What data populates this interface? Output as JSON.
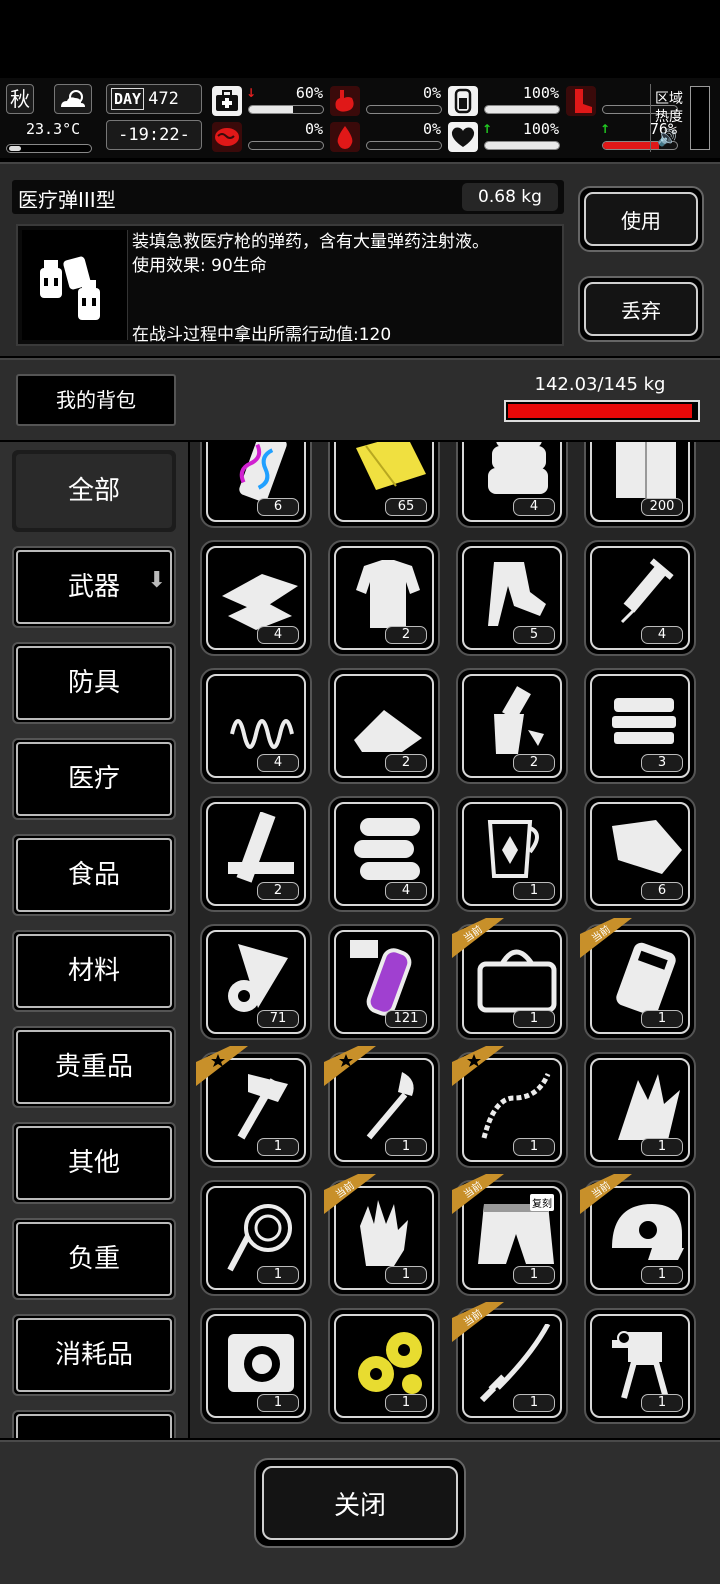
{
  "status": {
    "season": "秋",
    "temperature": "23.3°C",
    "day_label": "DAY",
    "day_number": "472",
    "time": "-19:22-",
    "stats": [
      {
        "key": "health",
        "icon": "medkit-icon",
        "arrow": "↓",
        "arrow_color": "#e02020",
        "value": "60%",
        "level": 0.6,
        "bar_color": "#e8e8e8"
      },
      {
        "key": "hunger",
        "icon": "stomach-icon",
        "arrow": "",
        "arrow_color": "",
        "value": "0%",
        "level": 0.0,
        "bar_color": "#e8e8e8"
      },
      {
        "key": "stamina",
        "icon": "battery-icon",
        "arrow": "",
        "arrow_color": "",
        "value": "100%",
        "level": 1.0,
        "bar_color": "#e8e8e8"
      },
      {
        "key": "leg",
        "icon": "boot-icon",
        "arrow": "",
        "arrow_color": "",
        "value": "",
        "level": 0.0,
        "bar_color": "#e01818"
      },
      {
        "key": "brain",
        "icon": "brain-icon",
        "arrow": "",
        "arrow_color": "",
        "value": "0%",
        "level": 0.0,
        "bar_color": "#e8e8e8"
      },
      {
        "key": "thirst",
        "icon": "water-drop-icon",
        "arrow": "",
        "arrow_color": "",
        "value": "0%",
        "level": 0.0,
        "bar_color": "#e8e8e8"
      },
      {
        "key": "mood",
        "icon": "heart-icon",
        "arrow": "↑",
        "arrow_color": "#22cc22",
        "value": "100%",
        "level": 1.0,
        "bar_color": "#e8e8e8"
      },
      {
        "key": "energy",
        "icon": "",
        "arrow": "↑",
        "arrow_color": "#22cc22",
        "value": "76%",
        "level": 0.76,
        "bar_color": "#e01818"
      }
    ],
    "area_label": "区域\n热度"
  },
  "item": {
    "name": "医疗弹III型",
    "weight": "0.68 kg",
    "description": "装填急救医疗枪的弹药，含有大量弹药注射液。",
    "effect": "使用效果: 90生命",
    "action_cost": "在战斗过程中拿出所需行动值:120",
    "use_label": "使用",
    "drop_label": "丢弃"
  },
  "bag": {
    "title": "我的背包",
    "capacity": "142.03/145 kg",
    "fill": 0.979
  },
  "categories": [
    {
      "label": "全部",
      "active": true
    },
    {
      "label": "武器",
      "active": false,
      "has_arrow": true
    },
    {
      "label": "防具",
      "active": false
    },
    {
      "label": "医疗",
      "active": false
    },
    {
      "label": "食品",
      "active": false
    },
    {
      "label": "材料",
      "active": false
    },
    {
      "label": "贵重品",
      "active": false
    },
    {
      "label": "其他",
      "active": false
    },
    {
      "label": "负重",
      "active": false
    },
    {
      "label": "消耗品",
      "active": false
    }
  ],
  "items": [
    {
      "icon": "vial-beta-icon",
      "qty": "6",
      "tag": ""
    },
    {
      "icon": "yellow-cloth-icon",
      "qty": "65",
      "tag": ""
    },
    {
      "icon": "folded-cloth-icon",
      "qty": "4",
      "tag": ""
    },
    {
      "icon": "white-fabric-icon",
      "qty": "200",
      "tag": ""
    },
    {
      "icon": "bandage-icon",
      "qty": "4",
      "tag": ""
    },
    {
      "icon": "torn-shirt-icon",
      "qty": "2",
      "tag": ""
    },
    {
      "icon": "torn-pants-icon",
      "qty": "5",
      "tag": ""
    },
    {
      "icon": "syringe-icon",
      "qty": "4",
      "tag": ""
    },
    {
      "icon": "spring-icon",
      "qty": "4",
      "tag": ""
    },
    {
      "icon": "powder-pile-icon",
      "qty": "2",
      "tag": ""
    },
    {
      "icon": "broken-bottle-icon",
      "qty": "2",
      "tag": ""
    },
    {
      "icon": "sandwich-icon",
      "qty": "3",
      "tag": ""
    },
    {
      "icon": "wood-planks-icon",
      "qty": "2",
      "tag": ""
    },
    {
      "icon": "logs-icon",
      "qty": "4",
      "tag": ""
    },
    {
      "icon": "herb-jug-icon",
      "qty": "1",
      "tag": ""
    },
    {
      "icon": "meat-icon",
      "qty": "6",
      "tag": ""
    },
    {
      "icon": "paper-roll-icon",
      "qty": "71",
      "tag": ""
    },
    {
      "icon": "purple-test-tube-icon",
      "qty": "121",
      "tag": ""
    },
    {
      "icon": "duffel-bag-icon",
      "qty": "1",
      "tag": "当前"
    },
    {
      "icon": "backpack-icon",
      "qty": "1",
      "tag": "当前"
    },
    {
      "icon": "hammer-axe-icon",
      "qty": "1",
      "tag": "star"
    },
    {
      "icon": "shovel-icon",
      "qty": "1",
      "tag": "star"
    },
    {
      "icon": "whip-chain-icon",
      "qty": "1",
      "tag": "star"
    },
    {
      "icon": "grass-bundle-icon",
      "qty": "1",
      "tag": ""
    },
    {
      "icon": "rope-icon",
      "qty": "1",
      "tag": ""
    },
    {
      "icon": "gloves-icon",
      "qty": "1",
      "tag": "当前"
    },
    {
      "icon": "shorts-icon",
      "qty": "1",
      "tag": "当前",
      "badge": "复刻"
    },
    {
      "icon": "cap-icon",
      "qty": "1",
      "tag": "当前"
    },
    {
      "icon": "engine-icon",
      "qty": "1",
      "tag": ""
    },
    {
      "icon": "gears-icon",
      "qty": "1",
      "tag": ""
    },
    {
      "icon": "katana-icon",
      "qty": "1",
      "tag": "当前"
    },
    {
      "icon": "turret-icon",
      "qty": "1",
      "tag": ""
    }
  ],
  "footer": {
    "close_label": "关闭"
  },
  "colors": {
    "accent_red": "#e80808",
    "tag_gold": "#c8902a",
    "star_gold": "#e0b020",
    "up_green": "#22cc22"
  }
}
